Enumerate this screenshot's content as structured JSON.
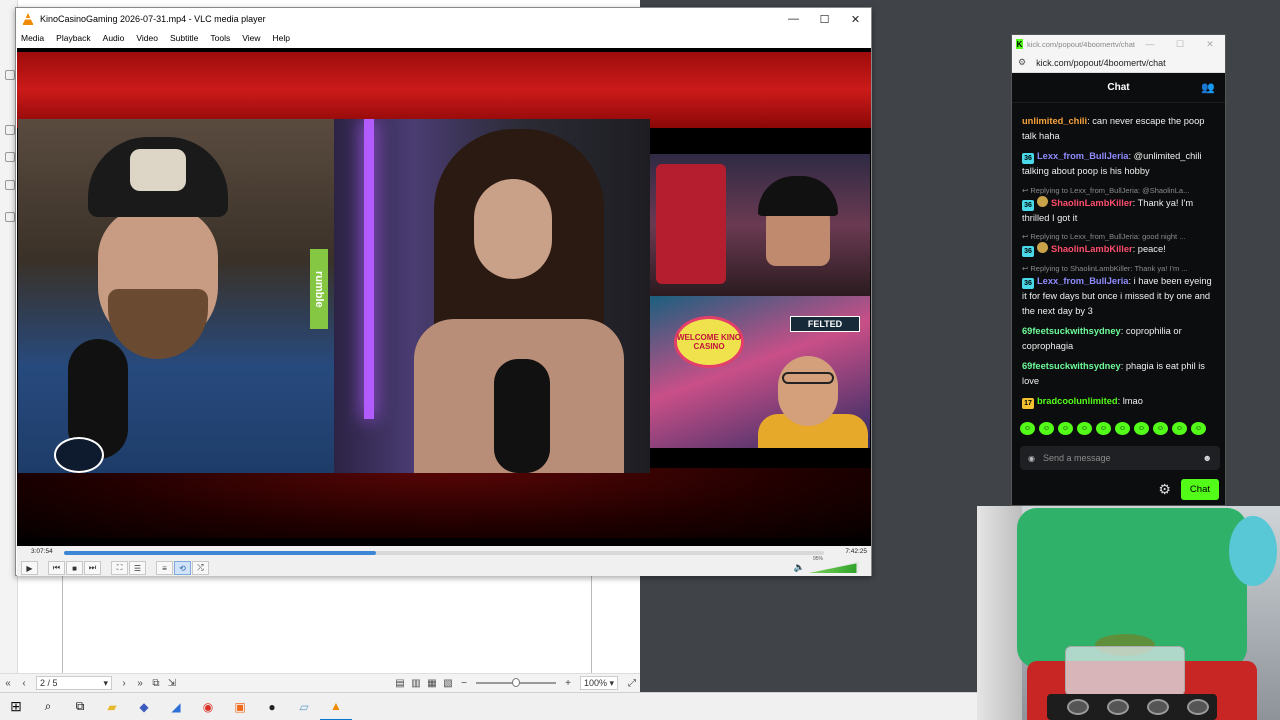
{
  "vlc": {
    "title": "KinoCasinoGaming 2026-07-31.mp4 - VLC media player",
    "menu": [
      "Media",
      "Playback",
      "Audio",
      "Video",
      "Subtitle",
      "Tools",
      "View",
      "Help"
    ],
    "time_elapsed": "3:07:54",
    "time_total": "7:42:25",
    "progress_fraction": 0.41,
    "volume_label": "95%",
    "volume_fraction": 0.95,
    "rumble_label": "rumble",
    "felted_label": "FELTED",
    "kino_sign": "WELCOME KINO CASINO",
    "window_buttons": [
      "—",
      "☐",
      "✕"
    ]
  },
  "background_app": {
    "page_field": "2 / 5",
    "zoom_field": "100%"
  },
  "kick": {
    "window_title": "kick.com/popout/4boomertv/chat",
    "url": "kick.com/popout/4boomertv/chat",
    "header": "Chat",
    "input_placeholder": "Send a message",
    "chat_button": "Chat",
    "colors": {
      "accent": "#53fc18",
      "bg": "#0c0d0e"
    },
    "messages": [
      {
        "reply": "",
        "badge": "",
        "user": "unlimited_chili",
        "user_color": "#f7a23b",
        "text": ": can never escape the poop talk haha"
      },
      {
        "reply": "",
        "badge": "36",
        "badge_color": "#49d9e8",
        "user": "Lexx_from_BullJeria",
        "user_color": "#8f8cff",
        "text": ": @unlimited_chili talking about poop is his hobby"
      },
      {
        "reply": "↩ Replying to Lexx_from_BullJeria: @ShaolinLa...",
        "badge": "36",
        "badge_color": "#49d9e8",
        "badge2": true,
        "user": "ShaolinLambKiller",
        "user_color": "#ff4d6d",
        "text": ": Thank ya! I'm thrilled I got it"
      },
      {
        "reply": "↩ Replying to Lexx_from_BullJeria: good night ...",
        "badge": "36",
        "badge_color": "#49d9e8",
        "badge2": true,
        "user": "ShaolinLambKiller",
        "user_color": "#ff4d6d",
        "text": ": peace!"
      },
      {
        "reply": "↩ Replying to ShaolinLambKiller: Thank ya! I'm ...",
        "badge": "36",
        "badge_color": "#49d9e8",
        "user": "Lexx_from_BullJeria",
        "user_color": "#8f8cff",
        "text": ": i have been eyeing it for few days but once i missed it by one and the next day by 3"
      },
      {
        "reply": "",
        "badge": "",
        "user": "69feetsuckwithsydney",
        "user_color": "#6dfc9a",
        "text": ": coprophilia or coprophagia"
      },
      {
        "reply": "",
        "badge": "",
        "user": "69feetsuckwithsydney",
        "user_color": "#6dfc9a",
        "text": ": phagia is eat phil is love"
      },
      {
        "reply": "",
        "badge": "17",
        "badge_color": "#f2c230",
        "user": "bradcoolunlimited",
        "user_color": "#53fc18",
        "text": ": lmao"
      }
    ]
  }
}
